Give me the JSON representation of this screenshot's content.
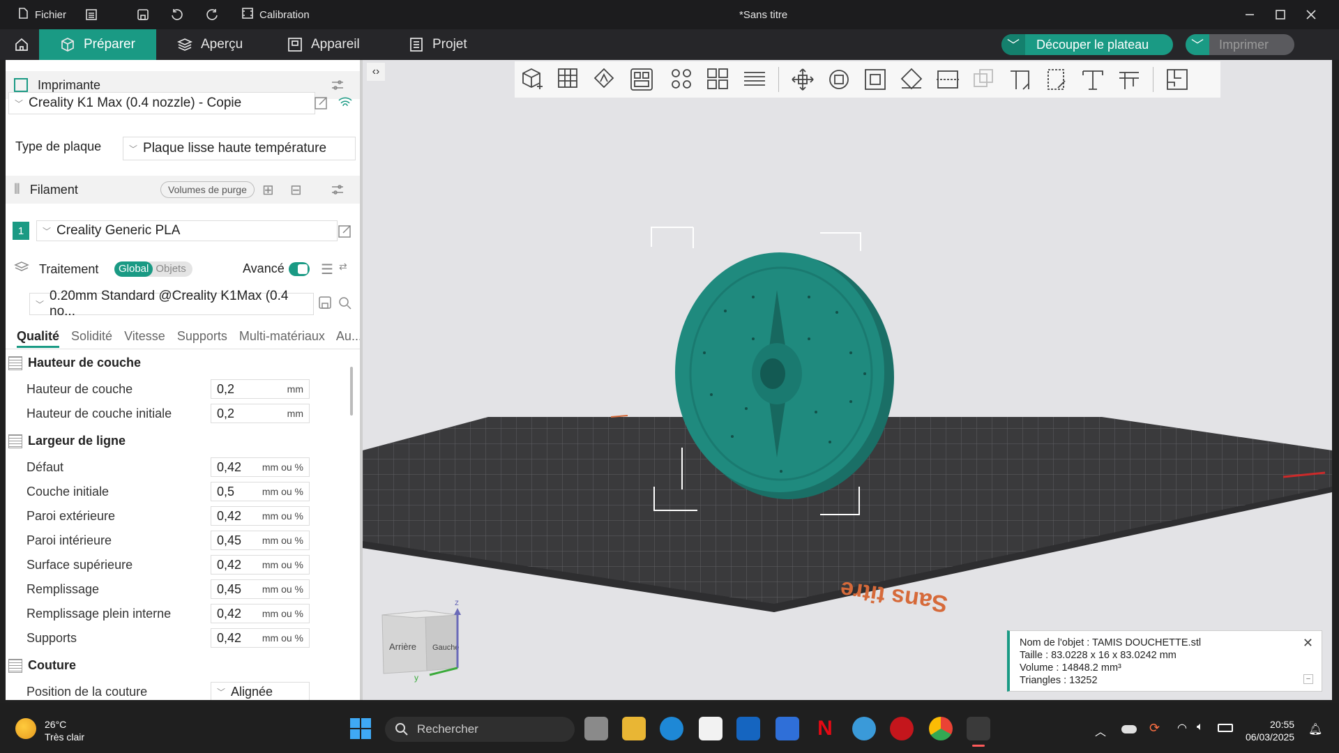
{
  "titlebar": {
    "file_menu": "Fichier",
    "calibration": "Calibration",
    "doc_title": "*Sans titre"
  },
  "tabs": [
    {
      "label": "Préparer"
    },
    {
      "label": "Aperçu"
    },
    {
      "label": "Appareil"
    },
    {
      "label": "Projet"
    }
  ],
  "actions": {
    "slice": "Découper le plateau",
    "print": "Imprimer"
  },
  "printer": {
    "section": "Imprimante",
    "name": "Creality K1 Max (0.4 nozzle) - Copie",
    "plate_label": "Type de plaque",
    "plate_value": "Plaque lisse haute température"
  },
  "filament": {
    "section": "Filament",
    "purge_button": "Volumes de purge",
    "slot": "1",
    "name": "Creality Generic PLA"
  },
  "process": {
    "section": "Traitement",
    "toggle_global": "Global",
    "toggle_objects": "Objets",
    "advanced": "Avancé",
    "profile": "0.20mm Standard @Creality K1Max (0.4 no..."
  },
  "subtabs": [
    "Qualité",
    "Solidité",
    "Vitesse",
    "Supports",
    "Multi-matériaux",
    "Au..."
  ],
  "groups": {
    "layer_height": {
      "title": "Hauteur de couche",
      "rows": [
        {
          "label": "Hauteur de couche",
          "value": "0,2",
          "unit": "mm"
        },
        {
          "label": "Hauteur de couche initiale",
          "value": "0,2",
          "unit": "mm"
        }
      ]
    },
    "line_width": {
      "title": "Largeur de ligne",
      "rows": [
        {
          "label": "Défaut",
          "value": "0,42",
          "unit": "mm ou %"
        },
        {
          "label": "Couche initiale",
          "value": "0,5",
          "unit": "mm ou %"
        },
        {
          "label": "Paroi extérieure",
          "value": "0,42",
          "unit": "mm ou %"
        },
        {
          "label": "Paroi intérieure",
          "value": "0,45",
          "unit": "mm ou %"
        },
        {
          "label": "Surface supérieure",
          "value": "0,42",
          "unit": "mm ou %"
        },
        {
          "label": "Remplissage",
          "value": "0,45",
          "unit": "mm ou %"
        },
        {
          "label": "Remplissage plein interne",
          "value": "0,42",
          "unit": "mm ou %"
        },
        {
          "label": "Supports",
          "value": "0,42",
          "unit": "mm ou %"
        }
      ]
    },
    "seam": {
      "title": "Couture",
      "rows": [
        {
          "label": "Position de la couture",
          "value": "Alignée"
        }
      ]
    }
  },
  "viewport": {
    "plate_label": "Sans titre",
    "cube_back": "Arrière",
    "cube_left": "Gauche",
    "axis_z": "z",
    "axis_y": "y"
  },
  "info": {
    "name": "Nom de l'objet : TAMIS DOUCHETTE.stl",
    "size": "Taille : 83.0228 x 16 x 83.0242 mm",
    "volume": "Volume : 14848.2 mm³",
    "triangles": "Triangles : 13252"
  },
  "taskbar": {
    "temp": "26°C",
    "weather": "Très clair",
    "search": "Rechercher",
    "time": "20:55",
    "date": "06/03/2025"
  },
  "colors": {
    "accent": "#1a9a84",
    "model": "#1f8a7e",
    "bed": "#3a3a3c"
  }
}
